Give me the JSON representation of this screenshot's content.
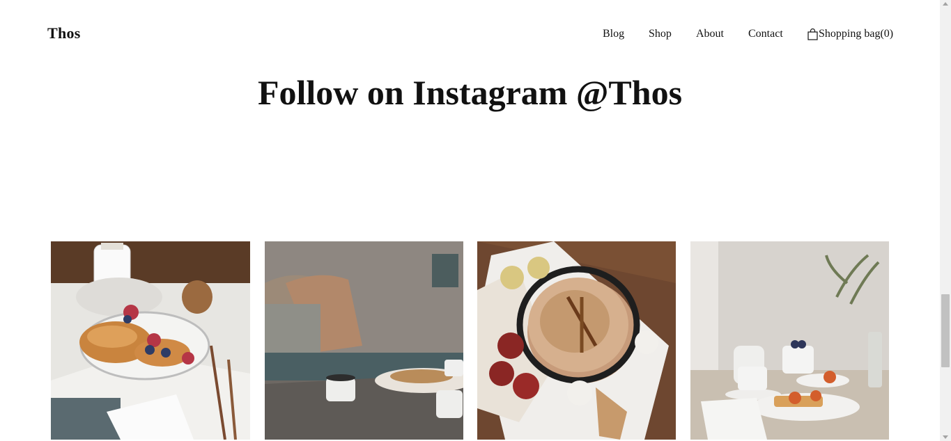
{
  "header": {
    "logo": "Thos",
    "nav": {
      "blog": "Blog",
      "shop": "Shop",
      "about": "About",
      "contact": "Contact",
      "bag_label": "Shopping bag",
      "bag_count": "(0)"
    }
  },
  "main": {
    "title": "Follow on Instagram @Thos"
  },
  "icons": {
    "bag": "shopping-bag-icon"
  },
  "colors": {
    "background": "#ffffff",
    "text": "#111111"
  }
}
